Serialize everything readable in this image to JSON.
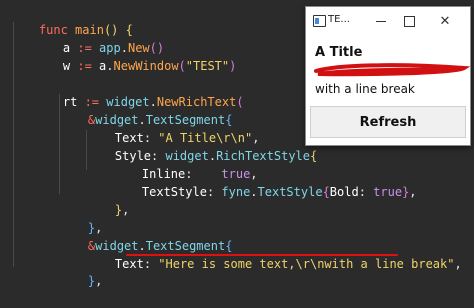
{
  "code": {
    "l1": [
      "func",
      " ",
      "main",
      "()",
      " {"
    ],
    "l2": [
      "a",
      " := ",
      "app",
      ".",
      "New",
      "()"
    ],
    "l3": [
      "w",
      " := ",
      "a",
      ".",
      "NewWindow",
      "(",
      "\"TEST\"",
      ")"
    ],
    "l5": [
      "rt",
      " := ",
      "widget",
      ".",
      "NewRichText",
      "("
    ],
    "l6": [
      "&",
      "widget",
      ".",
      "TextSegment",
      "{"
    ],
    "l7": [
      "Text",
      ": ",
      "\"A Title\\r\\n\"",
      ","
    ],
    "l8": [
      "Style",
      ": ",
      "widget",
      ".",
      "RichTextStyle",
      "{"
    ],
    "l9": [
      "Inline",
      ":    ",
      "true",
      ","
    ],
    "l10": [
      "TextStyle",
      ": ",
      "fyne",
      ".",
      "TextStyle",
      "{",
      "Bold",
      ": ",
      "true",
      "}",
      ","
    ],
    "l11": [
      "}",
      ","
    ],
    "l12": [
      "}",
      ","
    ],
    "l13": [
      "&",
      "widget",
      ".",
      "TextSegment",
      "{"
    ],
    "l14": [
      "Text",
      ": ",
      "\"Here is some text,\\r\\nwith a line break\"",
      ","
    ],
    "l15": [
      "}",
      ","
    ],
    "l16": [
      ")"
    ]
  },
  "window": {
    "title": "TE...",
    "heading": "A Title",
    "body_text": "with a line break",
    "button_label": "Refresh"
  },
  "colors": {
    "editor_bg": "#2b2b2b",
    "annotation_red": "#d11111"
  },
  "icons": {
    "app": "app-window-icon",
    "minimize": "minimize-icon",
    "maximize": "maximize-icon",
    "close": "close-icon"
  }
}
